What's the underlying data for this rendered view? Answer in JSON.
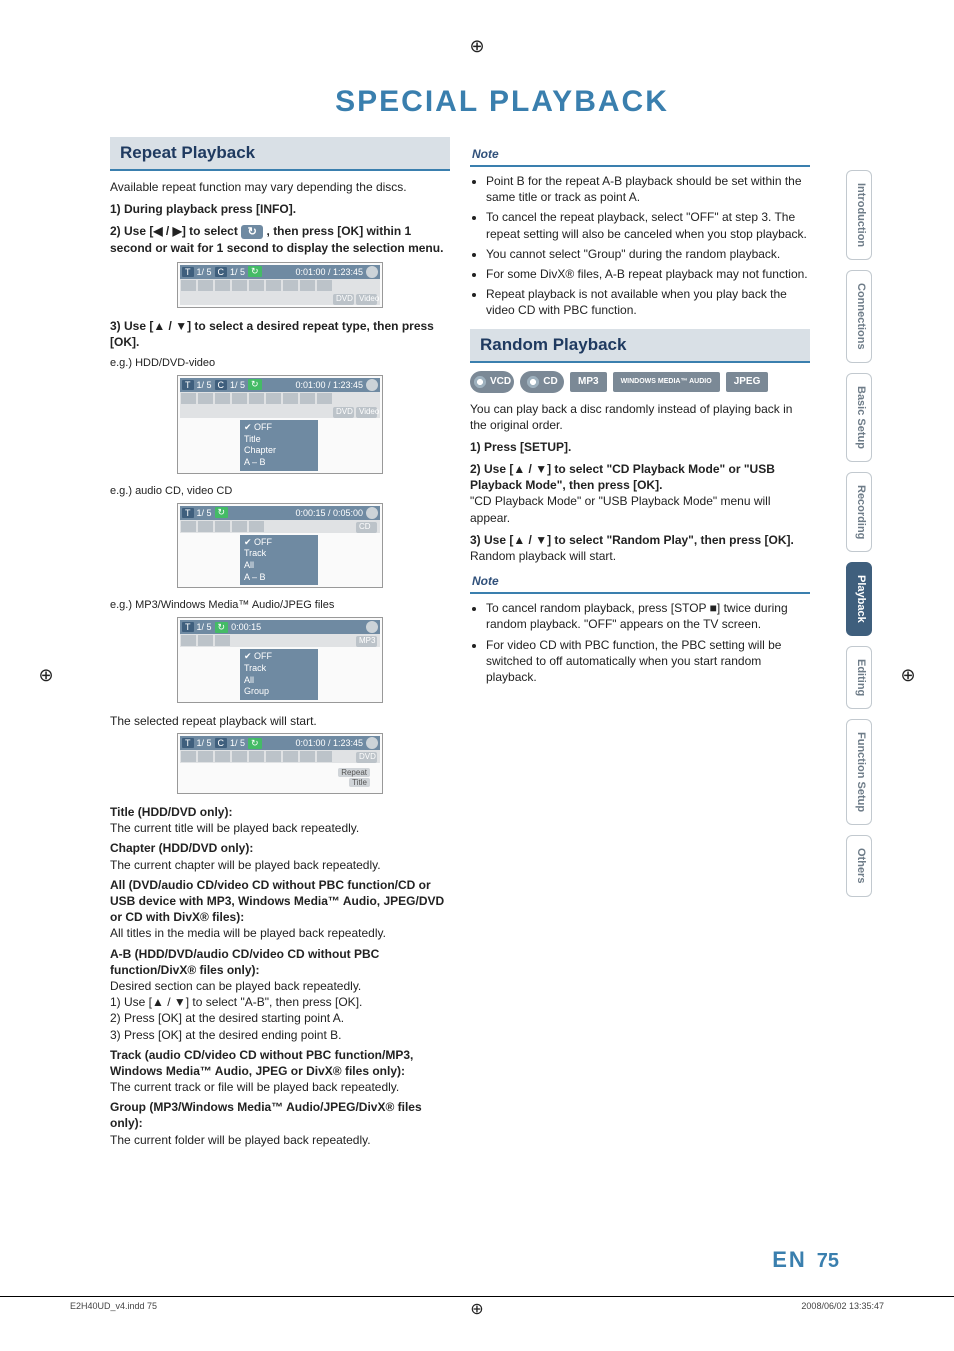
{
  "page": {
    "title": "SPECIAL PLAYBACK",
    "lang": "EN",
    "num": "75"
  },
  "footer": {
    "file": "E2H40UD_v4.indd   75",
    "timestamp": "2008/06/02   13:35:47"
  },
  "side_tabs": [
    "Introduction",
    "Connections",
    "Basic Setup",
    "Recording",
    "Playback",
    "Editing",
    "Function Setup",
    "Others"
  ],
  "active_tab_index": 4,
  "left": {
    "section_title": "Repeat Playback",
    "intro": "Available repeat function may vary depending the discs.",
    "step1": "1) During playback press [INFO].",
    "step2_a": "2) Use [",
    "step2_b": "] to select ",
    "step2_c": " , then press [OK] within 1 second or wait for 1 second to display the selection menu.",
    "step3": "3) Use [▲ / ▼] to select a desired repeat type, then press [OK].",
    "eg1": "e.g.) HDD/DVD-video",
    "eg2": "e.g.) audio CD, video CD",
    "eg3": "e.g.) MP3/Windows Media™ Audio/JPEG files",
    "osd1": {
      "tc": "1/   5",
      "cc": "1/   5",
      "time": "0:01:00 / 1:23:45",
      "tags": [
        "DVD",
        "Video"
      ],
      "menu": [
        "OFF",
        "Title",
        "Chapter",
        "A – B"
      ],
      "selected": 0
    },
    "osd2": {
      "tc": "1/   5",
      "time": "0:00:15 / 0:05:00",
      "tag": "CD",
      "menu": [
        "OFF",
        "Track",
        "All",
        "A – B"
      ],
      "selected": 0
    },
    "osd3": {
      "tc": "1/   5",
      "time": "0:00:15",
      "tag": "MP3",
      "menu": [
        "OFF",
        "Track",
        "All",
        "Group"
      ],
      "selected": 0
    },
    "selstart": "The selected repeat playback will start.",
    "osd4": {
      "tc": "1/   5",
      "cc": "1/   5",
      "time": "0:01:00 / 1:23:45",
      "tag": "DVD",
      "badge1": "Repeat",
      "badge2": "Title"
    },
    "title_h": "Title (HDD/DVD only):",
    "title_t": "The current title will be played back repeatedly.",
    "chap_h": "Chapter (HDD/DVD only):",
    "chap_t": "The current chapter will be played back repeatedly.",
    "all_h": "All (DVD/audio CD/video CD without PBC function/CD or USB device with MP3, Windows Media™ Audio, JPEG/DVD or CD with DivX® files):",
    "all_t": "All titles in the media will be played back repeatedly.",
    "ab_h": "A-B (HDD/DVD/audio CD/video CD without PBC function/DivX® files only):",
    "ab_t0": "Desired section can be played back repeatedly.",
    "ab_t1": "1) Use [▲ / ▼] to select \"A-B\", then press [OK].",
    "ab_t2": "2) Press [OK] at the desired starting point A.",
    "ab_t3": "3) Press [OK] at the desired ending point B.",
    "track_h": "Track (audio CD/video CD without PBC function/MP3, Windows Media™ Audio, JPEG or DivX® files only):",
    "track_t": "The current track or file will be played back repeatedly.",
    "group_h": "Group (MP3/Windows Media™ Audio/JPEG/DivX® files only):",
    "group_t": "The current folder will be played back repeatedly."
  },
  "right": {
    "note_head": "Note",
    "notes_top": [
      "Point B for the repeat A-B playback should be set within the same title or track as point A.",
      "To cancel the repeat playback, select \"OFF\" at step 3. The repeat setting will also be canceled when you stop playback.",
      "You cannot select \"Group\" during the random playback.",
      "For some DivX® files, A-B repeat playback may not function.",
      "Repeat playback is not available when you play back the video CD with PBC function."
    ],
    "section_title": "Random Playback",
    "formats": [
      "VCD",
      "CD",
      "MP3",
      "WINDOWS MEDIA™ AUDIO",
      "JPEG"
    ],
    "intro": "You can play back a disc randomly instead of playing back in the original order.",
    "step1": "1) Press [SETUP].",
    "step2_h": "2) Use [▲ / ▼] to select \"CD Playback Mode\" or \"USB Playback Mode\", then press [OK].",
    "step2_t": "\"CD Playback Mode\" or \"USB Playback Mode\" menu will appear.",
    "step3_h": "3) Use [▲ / ▼] to select \"Random Play\", then press [OK].",
    "step3_t": "Random playback will start.",
    "notes_bottom": [
      "To cancel random playback, press [STOP ■] twice during random playback. \"OFF\" appears on the TV screen.",
      "For video CD with PBC function, the PBC setting will be switched to off automatically when you start random playback."
    ]
  }
}
